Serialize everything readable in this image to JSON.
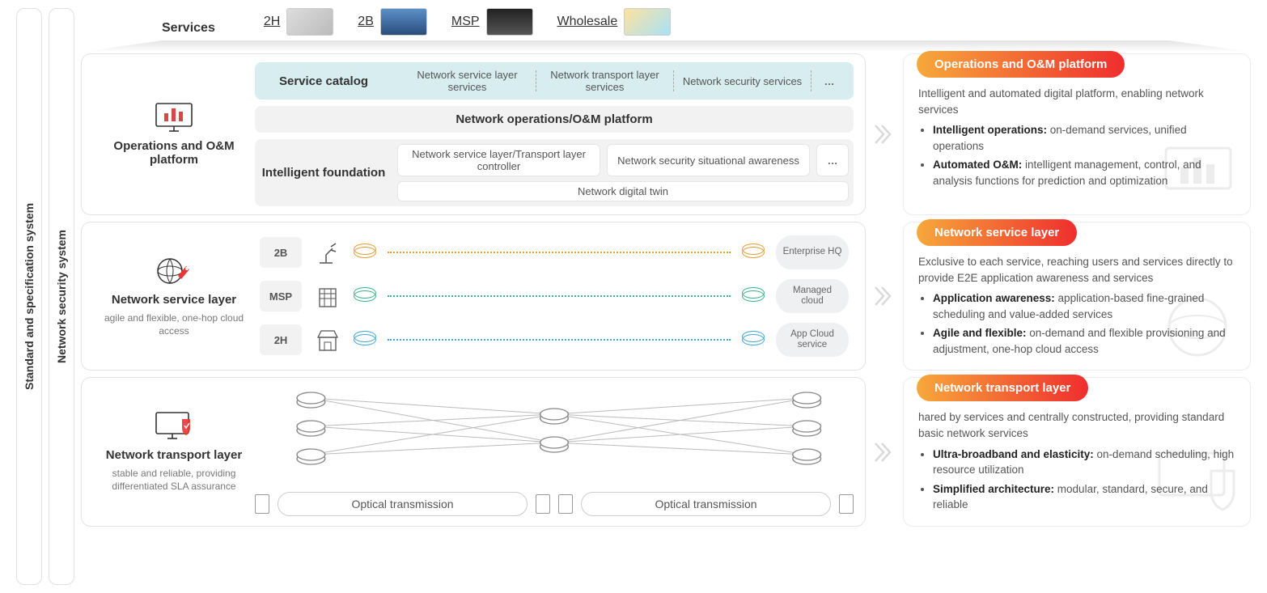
{
  "vbars": {
    "standard": "Standard and specification system",
    "security": "Network security system"
  },
  "services": {
    "label": "Services",
    "items": [
      "2H",
      "2B",
      "MSP",
      "Wholesale"
    ]
  },
  "platform": {
    "leftTitle": "Operations and O&M platform",
    "catalog": {
      "head": "Service catalog",
      "cells": [
        "Network service layer services",
        "Network transport layer services",
        "Network security services"
      ],
      "ellipsis": "…"
    },
    "oamCenter": "Network operations/O&M platform",
    "intel": {
      "head": "Intelligent foundation",
      "top": [
        "Network service layer/Transport layer controller",
        "Network security situational awareness"
      ],
      "ellipsis": "…",
      "bottom": "Network digital twin"
    }
  },
  "serviceLayer": {
    "title": "Network service layer",
    "sub": "agile and flexible, one-hop cloud access",
    "rows": [
      {
        "tag": "2B",
        "cloud": "Enterprise HQ",
        "color": "o"
      },
      {
        "tag": "MSP",
        "cloud": "Managed cloud",
        "color": "g"
      },
      {
        "tag": "2H",
        "cloud": "App Cloud service",
        "color": "b"
      }
    ]
  },
  "transport": {
    "title": "Network transport layer",
    "sub": "stable and reliable, providing differentiated SLA assurance",
    "optical": "Optical transmission"
  },
  "cards": {
    "c1": {
      "badge": "Operations and O&M platform",
      "lead": "Intelligent and automated digital platform, enabling network services",
      "b1t": "Intelligent operations:",
      "b1d": " on-demand services, unified operations",
      "b2t": "Automated O&M:",
      "b2d": " intelligent management, control, and analysis functions for prediction and optimization"
    },
    "c2": {
      "badge": "Network service layer",
      "lead": "Exclusive to each service, reaching users and services directly to provide E2E application awareness and services",
      "b1t": "Application awareness:",
      "b1d": " application-based fine-grained scheduling and value-added services",
      "b2t": "Agile and flexible:",
      "b2d": " on-demand and flexible provisioning and adjustment, one-hop cloud access"
    },
    "c3": {
      "badge": "Network transport layer",
      "lead": "hared by services and centrally constructed, providing standard basic network services",
      "b1t": "Ultra-broadband and elasticity:",
      "b1d": " on-demand scheduling, high resource utilization",
      "b2t": "Simplified architecture:",
      "b2d": " modular, standard, secure, and reliable"
    }
  }
}
